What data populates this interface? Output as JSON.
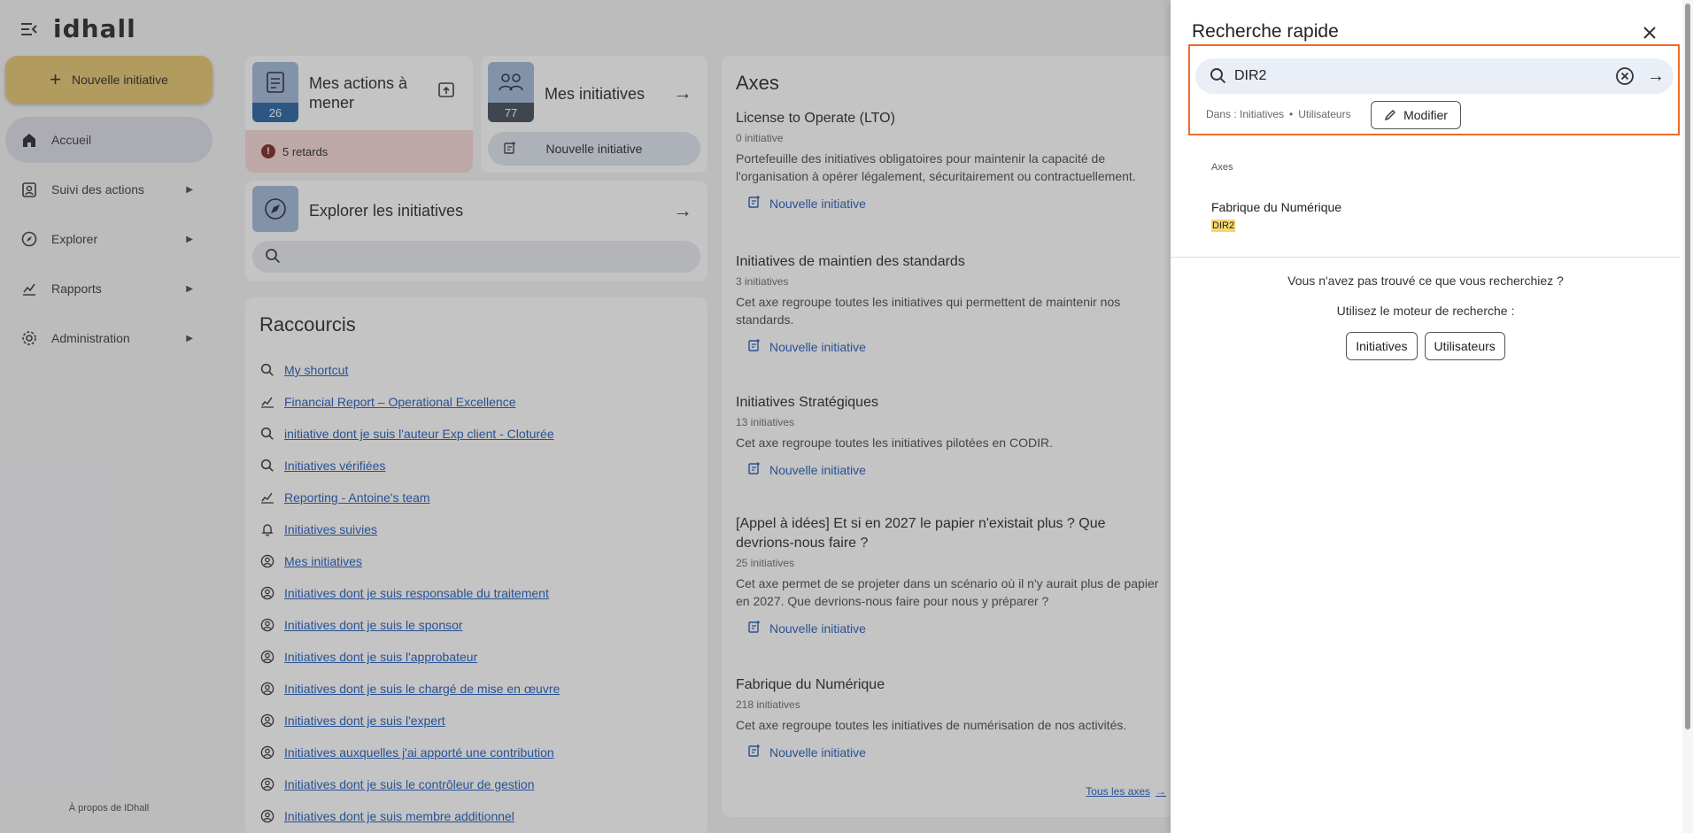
{
  "app": {
    "logo": "idhall"
  },
  "sidebar": {
    "new_initiative": "Nouvelle initiative",
    "items": [
      {
        "label": "Accueil",
        "active": true,
        "icon": "home-icon"
      },
      {
        "label": "Suivi des actions",
        "icon": "clipboard-user-icon"
      },
      {
        "label": "Explorer",
        "icon": "compass-icon"
      },
      {
        "label": "Rapports",
        "icon": "chart-icon"
      },
      {
        "label": "Administration",
        "icon": "gear-icon"
      }
    ],
    "about": "À propos de IDhall"
  },
  "cards": {
    "actions": {
      "title": "Mes actions à mener",
      "count": "26",
      "retards": "5 retards"
    },
    "initiatives": {
      "title": "Mes initiatives",
      "count": "77",
      "new_button": "Nouvelle initiative"
    },
    "explore": {
      "title": "Explorer les initiatives"
    }
  },
  "shortcuts": {
    "title": "Raccourcis",
    "items": [
      {
        "label": "My shortcut",
        "icon": "search-icon"
      },
      {
        "label": "Financial Report – Operational Excellence",
        "icon": "chart-icon"
      },
      {
        "label": "initiative dont je suis l'auteur Exp client - Cloturée",
        "icon": "search-icon"
      },
      {
        "label": "Initiatives vérifiées",
        "icon": "search-icon"
      },
      {
        "label": "Reporting - Antoine's team",
        "icon": "chart-icon"
      },
      {
        "label": "Initiatives suivies",
        "icon": "bell-icon"
      },
      {
        "label": "Mes initiatives",
        "icon": "user-circle-icon"
      },
      {
        "label": "Initiatives dont je suis responsable du traitement",
        "icon": "user-circle-icon"
      },
      {
        "label": "Initiatives dont je suis le sponsor",
        "icon": "user-circle-icon"
      },
      {
        "label": "Initiatives dont je suis l'approbateur",
        "icon": "user-circle-icon"
      },
      {
        "label": "Initiatives dont je suis le chargé de mise en œuvre",
        "icon": "user-circle-icon"
      },
      {
        "label": "Initiatives dont je suis l'expert",
        "icon": "user-circle-icon"
      },
      {
        "label": "Initiatives auxquelles j'ai apporté une contribution",
        "icon": "user-circle-icon"
      },
      {
        "label": "Initiatives dont je suis le contrôleur de gestion",
        "icon": "user-circle-icon"
      },
      {
        "label": "Initiatives dont je suis membre additionnel",
        "icon": "user-circle-icon"
      }
    ]
  },
  "axes": {
    "title": "Axes",
    "new_label": "Nouvelle initiative",
    "all_link": "Tous les axes",
    "items": [
      {
        "title": "License to Operate (LTO)",
        "count": "0 initiative",
        "desc": "Portefeuille des initiatives obligatoires pour maintenir la capacité de l'organisation à opérer légalement, sécuritairement ou contractuellement."
      },
      {
        "title": "Initiatives de maintien des standards",
        "count": "3 initiatives",
        "desc": "Cet axe regroupe toutes les initiatives qui permettent de maintenir nos standards."
      },
      {
        "title": "Initiatives Stratégiques",
        "count": "13 initiatives",
        "desc": "Cet axe regroupe toutes les initiatives pilotées en CODIR."
      },
      {
        "title": "[Appel à idées] Et si en 2027 le papier n'existait plus ? Que devrions-nous faire ?",
        "count": "25 initiatives",
        "desc": "Cet axe permet de se projeter dans un scénario où il n'y aurait plus de papier en 2027. Que devrions-nous faire pour nous y préparer ?"
      },
      {
        "title": "Fabrique du Numérique",
        "count": "218 initiatives",
        "desc": "Cet axe regroupe toutes les initiatives de numérisation de nos activités."
      }
    ]
  },
  "quick_search": {
    "title": "Recherche rapide",
    "query": "DIR2",
    "scope_prefix": "Dans : Initiatives",
    "scope_sep": "•",
    "scope_users": "Utilisateurs",
    "modify": "Modifier",
    "section": "Axes",
    "result_title": "Fabrique du Numérique",
    "result_tag": "DIR2",
    "not_found": "Vous n'avez pas trouvé ce que vous recherchiez ?",
    "use_engine": "Utilisez le moteur de recherche :",
    "engine_initiatives": "Initiatives",
    "engine_users": "Utilisateurs"
  },
  "colors": {
    "accent_yellow": "#e5c36a",
    "link_blue": "#1a56b8",
    "highlight_orange": "#ef6a2a",
    "retards_bg": "#f6d6d4",
    "actions_count_bg": "#1f5fa0",
    "initiatives_count_bg": "#3c4654"
  }
}
